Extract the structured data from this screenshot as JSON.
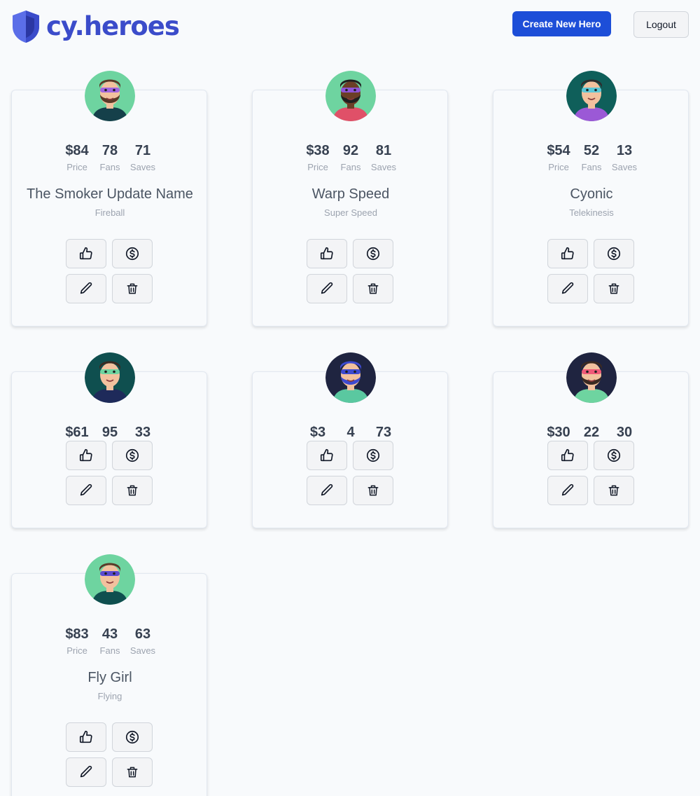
{
  "header": {
    "logo_text": "cy.heroes",
    "create_label": "Create New Hero",
    "logout_label": "Logout",
    "brand_color": "#3b4cca",
    "primary_color": "#1d4ed8"
  },
  "stat_labels": {
    "price": "Price",
    "fans": "Fans",
    "saves": "Saves"
  },
  "action_icons": [
    "thumbs-up-icon",
    "dollar-icon",
    "pencil-icon",
    "trash-icon"
  ],
  "heroes": [
    {
      "price": "$84",
      "fans": "78",
      "saves": "71",
      "name": "The Smoker Update Name",
      "power": "Fireball",
      "show_details": true
    },
    {
      "price": "$38",
      "fans": "92",
      "saves": "81",
      "name": "Warp Speed",
      "power": "Super Speed",
      "show_details": true
    },
    {
      "price": "$54",
      "fans": "52",
      "saves": "13",
      "name": "Cyonic",
      "power": "Telekinesis",
      "show_details": true
    },
    {
      "price": "$61",
      "fans": "95",
      "saves": "33",
      "name": "",
      "power": "",
      "show_details": false
    },
    {
      "price": "$3",
      "fans": "4",
      "saves": "73",
      "name": "",
      "power": "",
      "show_details": false
    },
    {
      "price": "$30",
      "fans": "22",
      "saves": "30",
      "name": "",
      "power": "",
      "show_details": false
    },
    {
      "price": "$83",
      "fans": "43",
      "saves": "63",
      "name": "Fly Girl",
      "power": "Flying",
      "show_details": true
    }
  ]
}
